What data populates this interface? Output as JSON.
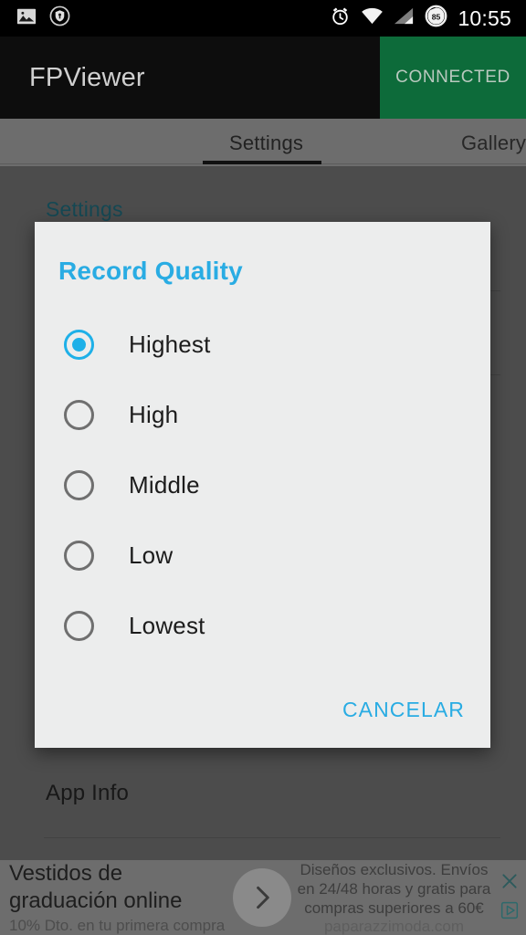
{
  "statusbar": {
    "time": "10:55",
    "battery_level": "85",
    "icons": [
      "image-icon",
      "shield-icon",
      "alarm-icon",
      "wifi-icon",
      "signal-icon",
      "battery-icon"
    ]
  },
  "appbar": {
    "title": "FPViewer",
    "connection_label": "CONNECTED",
    "connection_color": "#0d6b3a"
  },
  "tabs": [
    {
      "label": "Settings",
      "selected": true
    },
    {
      "label": "Gallery",
      "selected": false
    }
  ],
  "page": {
    "section_title": "Settings",
    "section_title_color": "#1f6778",
    "app_info_label": "App Info"
  },
  "dialog": {
    "title": "Record Quality",
    "title_color": "#29ace3",
    "accent_color": "#1eb0e8",
    "background": "#eceded",
    "options": [
      {
        "label": "Highest",
        "selected": true
      },
      {
        "label": "High",
        "selected": false
      },
      {
        "label": "Middle",
        "selected": false
      },
      {
        "label": "Low",
        "selected": false
      },
      {
        "label": "Lowest",
        "selected": false
      }
    ],
    "cancel_label": "CANCELAR"
  },
  "ad": {
    "headline": "Vestidos de graduación online",
    "subline": "10% Dto. en tu primera compra",
    "body": "Diseños exclusivos. Envíos en 24/48 horas y gratis para compras superiores a 60€",
    "url": "paparazzimoda.com",
    "arrow_icon": "chevron-right-icon",
    "close_icon": "close-icon",
    "adchoices_icon": "adchoices-triangle-icon"
  }
}
